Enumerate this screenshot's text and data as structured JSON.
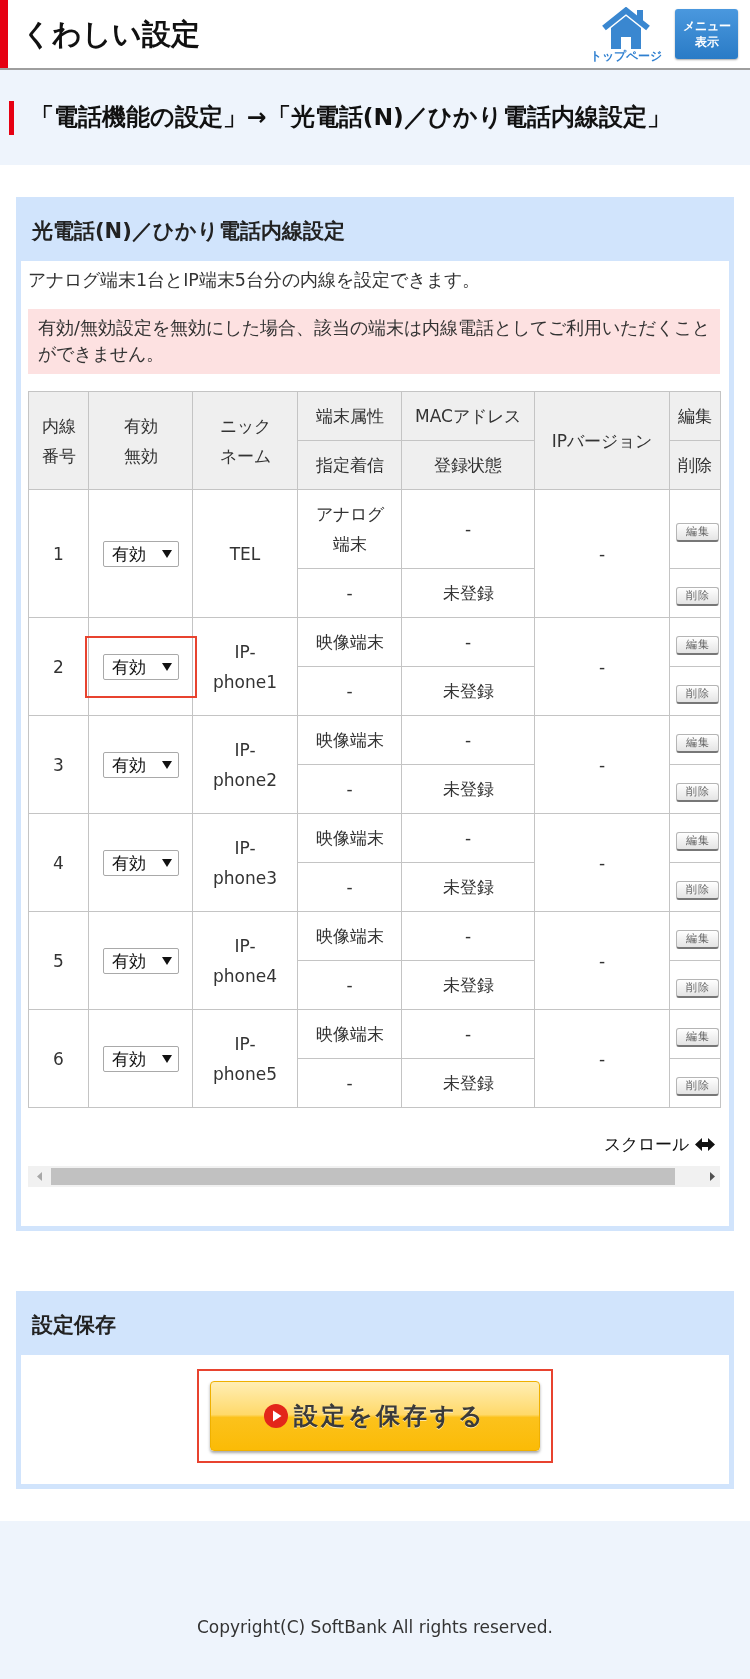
{
  "header": {
    "title": "くわしい設定",
    "home_link": "トップページ",
    "menu_button": "メニュー表示"
  },
  "breadcrumb": "「電話機能の設定」→「光電話(N)／ひかり電話内線設定」",
  "extension_panel": {
    "title": "光電話(N)／ひかり電話内線設定",
    "description": "アナログ端末1台とIP端末5台分の内線を設定できます。",
    "warning": "有効/無効設定を無効にした場合、該当の端末は内線電話としてご利用いただくことができません。",
    "table": {
      "columns": [
        {
          "label": "内線番号"
        },
        {
          "label": "有効無効"
        },
        {
          "label": "ニックネーム"
        },
        {
          "label": "端末属性",
          "sub_label": "指定着信"
        },
        {
          "label": "MACアドレス",
          "sub_label": "登録状態"
        },
        {
          "label": "IPバージョン"
        },
        {
          "label": "編集",
          "sub_label": "削除"
        }
      ],
      "rows": [
        {
          "number": "1",
          "status": "有効",
          "highlighted": false,
          "nickname": "TEL",
          "terminal_type": "アナログ端末",
          "mac_address": "-",
          "designated_incoming": "-",
          "registration": "未登録",
          "ip_version": "-",
          "edit_button": "編集",
          "delete_button": "削除"
        },
        {
          "number": "2",
          "status": "有効",
          "highlighted": true,
          "nickname": "IP-phone1",
          "terminal_type": "映像端末",
          "mac_address": "-",
          "designated_incoming": "-",
          "registration": "未登録",
          "ip_version": "-",
          "edit_button": "編集",
          "delete_button": "削除"
        },
        {
          "number": "3",
          "status": "有効",
          "highlighted": false,
          "nickname": "IP-phone2",
          "terminal_type": "映像端末",
          "mac_address": "-",
          "designated_incoming": "-",
          "registration": "未登録",
          "ip_version": "-",
          "edit_button": "編集",
          "delete_button": "削除"
        },
        {
          "number": "4",
          "status": "有効",
          "highlighted": false,
          "nickname": "IP-phone3",
          "terminal_type": "映像端末",
          "mac_address": "-",
          "designated_incoming": "-",
          "registration": "未登録",
          "ip_version": "-",
          "edit_button": "編集",
          "delete_button": "削除"
        },
        {
          "number": "5",
          "status": "有効",
          "highlighted": false,
          "nickname": "IP-phone4",
          "terminal_type": "映像端末",
          "mac_address": "-",
          "designated_incoming": "-",
          "registration": "未登録",
          "ip_version": "-",
          "edit_button": "編集",
          "delete_button": "削除"
        },
        {
          "number": "6",
          "status": "有効",
          "highlighted": false,
          "nickname": "IP-phone5",
          "terminal_type": "映像端末",
          "mac_address": "-",
          "designated_incoming": "-",
          "registration": "未登録",
          "ip_version": "-",
          "edit_button": "編集",
          "delete_button": "削除"
        }
      ]
    },
    "scroll_hint": "スクロール"
  },
  "save_panel": {
    "title": "設定保存",
    "button": {
      "label": "設定を保存する",
      "highlighted": true
    }
  },
  "footer": "Copyright(C) SoftBank All rights reserved."
}
